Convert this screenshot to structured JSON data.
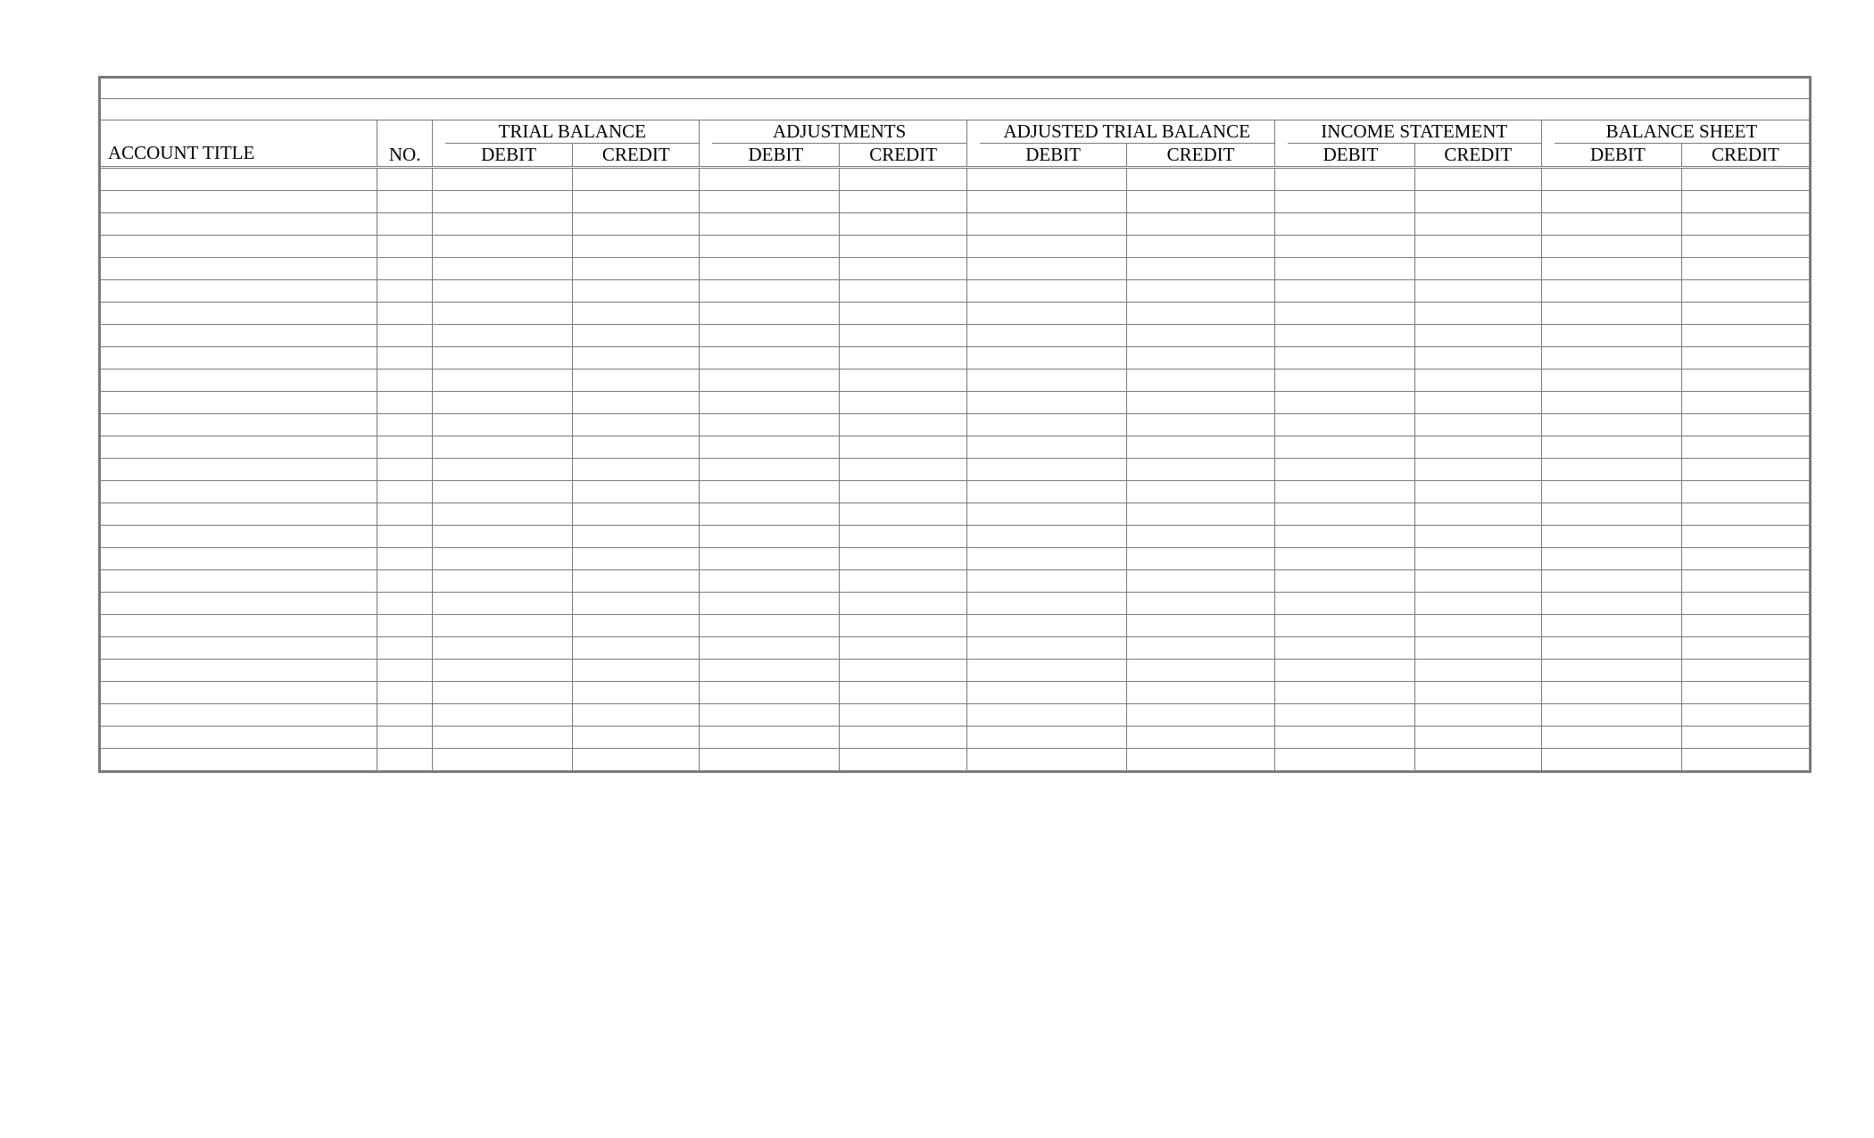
{
  "worksheet": {
    "headers": {
      "account_title": "ACCOUNT TITLE",
      "no": "NO.",
      "debit": "DEBIT",
      "credit": "CREDIT",
      "sections": {
        "trial_balance": "TRIAL BALANCE",
        "adjustments": "ADJUSTMENTS",
        "adjusted_trial_balance": "ADJUSTED TRIAL BALANCE",
        "income_statement": "INCOME STATEMENT",
        "balance_sheet": "BALANCE SHEET"
      }
    },
    "row_count": 27
  }
}
